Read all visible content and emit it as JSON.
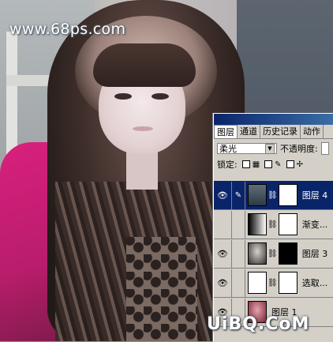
{
  "watermark_text": "www.68ps.com",
  "brand_text": "UiBQ.CoM",
  "layers_panel": {
    "tabs": [
      {
        "label": "图层",
        "active": true
      },
      {
        "label": "通道",
        "active": false
      },
      {
        "label": "历史记录",
        "active": false
      },
      {
        "label": "动作",
        "active": false
      }
    ],
    "blend_mode": "柔光",
    "opacity_label": "不透明度:",
    "lock_label": "锁定:",
    "layers": [
      {
        "name": "图层 4",
        "visible": true,
        "selected": true
      },
      {
        "name": "渐变...",
        "visible": false,
        "selected": false
      },
      {
        "name": "图层 3",
        "visible": true,
        "selected": false
      },
      {
        "name": "选取...",
        "visible": true,
        "selected": false
      },
      {
        "name": "图层 1",
        "visible": true,
        "selected": false
      }
    ]
  },
  "colors": {
    "selected_layer": "#0a246a",
    "panel_bg": "#d4d0c8",
    "pink_top": "#d9207d"
  }
}
